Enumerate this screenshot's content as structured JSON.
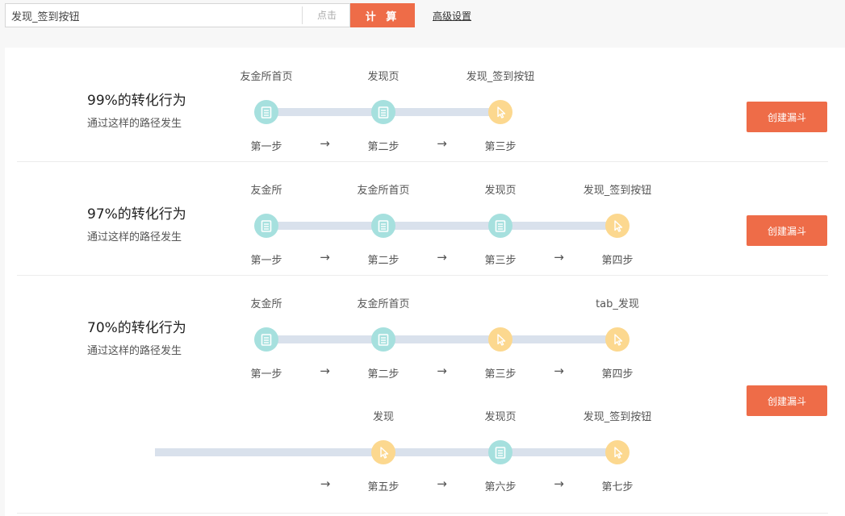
{
  "search": {
    "value": "发现_签到按钮",
    "hint": "点击",
    "calc_label": "计 算",
    "advanced_label": "高级设置"
  },
  "paths": [
    {
      "title": "99%的转化行为",
      "subtitle": "通过这样的路径发生",
      "button_label": "创建漏斗",
      "steps": [
        {
          "name": "友金所首页",
          "label": "第一步",
          "type": "page"
        },
        {
          "name": "发现页",
          "label": "第二步",
          "type": "page"
        },
        {
          "name": "发现_签到按钮",
          "label": "第三步",
          "type": "click"
        }
      ]
    },
    {
      "title": "97%的转化行为",
      "subtitle": "通过这样的路径发生",
      "button_label": "创建漏斗",
      "steps": [
        {
          "name": "友金所",
          "label": "第一步",
          "type": "page"
        },
        {
          "name": "友金所首页",
          "label": "第二步",
          "type": "page"
        },
        {
          "name": "发现页",
          "label": "第三步",
          "type": "page"
        },
        {
          "name": "发现_签到按钮",
          "label": "第四步",
          "type": "click"
        }
      ]
    },
    {
      "title": "70%的转化行为",
      "subtitle": "通过这样的路径发生",
      "button_label": "创建漏斗",
      "steps": [
        {
          "name": "友金所",
          "label": "第一步",
          "type": "page"
        },
        {
          "name": "友金所首页",
          "label": "第二步",
          "type": "page"
        },
        {
          "name": "",
          "label": "第三步",
          "type": "click"
        },
        {
          "name": "tab_发现",
          "label": "第四步",
          "type": "click"
        },
        {
          "name": "发现",
          "label": "第五步",
          "type": "click"
        },
        {
          "name": "发现页",
          "label": "第六步",
          "type": "page"
        },
        {
          "name": "发现_签到按钮",
          "label": "第七步",
          "type": "click"
        }
      ]
    }
  ],
  "arrow_glyph": "→",
  "colors": {
    "accent": "#ee6c48",
    "page_node": "#a6e0de",
    "click_node": "#fcd88f",
    "track": "#d9e1ec"
  },
  "icons": {
    "page": "page-icon",
    "click": "cursor-icon"
  }
}
